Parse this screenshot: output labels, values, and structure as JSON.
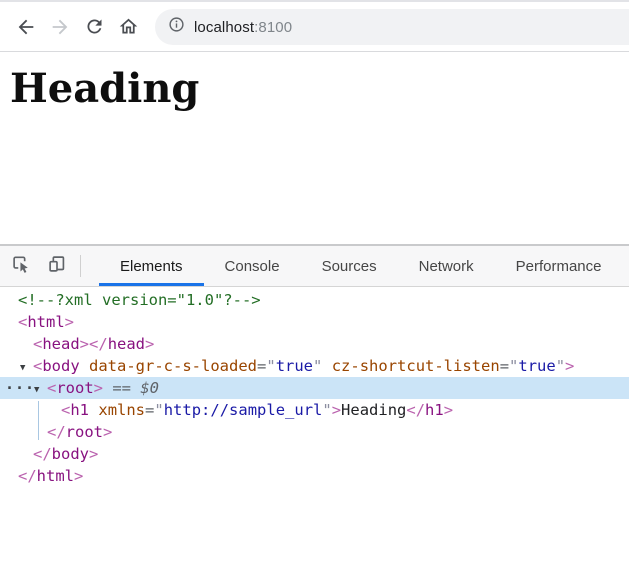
{
  "colors": {
    "accent_blue": "#1a73e8",
    "selected_row": "#cbe4f7",
    "syntax_comment": "#236e25",
    "syntax_tag": "#881280",
    "syntax_attr": "#994500",
    "syntax_value": "#1a1aa6"
  },
  "browser": {
    "icons": {
      "back": "arrow-left",
      "forward": "arrow-right",
      "reload": "refresh-circular-arrow",
      "home": "house-outline",
      "site_info": "info-circle"
    },
    "url": {
      "host": "localhost",
      "port": ":8100",
      "full": "localhost:8100"
    }
  },
  "page": {
    "heading": "Heading"
  },
  "devtools": {
    "toolbar_icons": {
      "inspect": "inspect-element-cursor",
      "device": "device-toolbar-phones"
    },
    "tabs": [
      {
        "label": "Elements",
        "active": true
      },
      {
        "label": "Console",
        "active": false
      },
      {
        "label": "Sources",
        "active": false
      },
      {
        "label": "Network",
        "active": false
      },
      {
        "label": "Performance",
        "active": false
      }
    ],
    "code": {
      "lines": [
        {
          "indent": 0,
          "segments": [
            {
              "t": "<!--?xml version=\"1.0\"?-->",
              "c": "comment"
            }
          ]
        },
        {
          "indent": 0,
          "segments": [
            {
              "t": "<",
              "c": "bracket"
            },
            {
              "t": "html",
              "c": "tag"
            },
            {
              "t": ">",
              "c": "bracket"
            }
          ]
        },
        {
          "indent": 1,
          "segments": [
            {
              "t": "<",
              "c": "bracket"
            },
            {
              "t": "head",
              "c": "tag"
            },
            {
              "t": ">",
              "c": "bracket"
            },
            {
              "t": "</",
              "c": "bracket"
            },
            {
              "t": "head",
              "c": "tag"
            },
            {
              "t": ">",
              "c": "bracket"
            }
          ]
        },
        {
          "indent": 1,
          "arrow": true,
          "segments": [
            {
              "t": "<",
              "c": "bracket"
            },
            {
              "t": "body",
              "c": "tag"
            },
            {
              "t": " ",
              "c": "plain"
            },
            {
              "t": "data-gr-c-s-loaded",
              "c": "attr"
            },
            {
              "t": "=",
              "c": "punct"
            },
            {
              "t": "\"",
              "c": "quote"
            },
            {
              "t": "true",
              "c": "value"
            },
            {
              "t": "\"",
              "c": "quote"
            },
            {
              "t": " ",
              "c": "plain"
            },
            {
              "t": "cz-shortcut-listen",
              "c": "attr"
            },
            {
              "t": "=",
              "c": "punct"
            },
            {
              "t": "\"",
              "c": "quote"
            },
            {
              "t": "true",
              "c": "value"
            },
            {
              "t": "\"",
              "c": "quote"
            },
            {
              "t": ">",
              "c": "bracket"
            }
          ]
        },
        {
          "indent": 2,
          "arrow": true,
          "selected": true,
          "dots": true,
          "segments": [
            {
              "t": "<",
              "c": "bracket"
            },
            {
              "t": "root",
              "c": "tag"
            },
            {
              "t": ">",
              "c": "bracket"
            },
            {
              "t": " == ",
              "c": "meta"
            },
            {
              "t": "$0",
              "c": "meta-italic"
            }
          ]
        },
        {
          "indent": 3,
          "segments": [
            {
              "t": "<",
              "c": "bracket"
            },
            {
              "t": "h1",
              "c": "tag"
            },
            {
              "t": " ",
              "c": "plain"
            },
            {
              "t": "xmlns",
              "c": "attr"
            },
            {
              "t": "=",
              "c": "punct"
            },
            {
              "t": "\"",
              "c": "quote"
            },
            {
              "t": "http://sample_url",
              "c": "value"
            },
            {
              "t": "\"",
              "c": "quote"
            },
            {
              "t": ">",
              "c": "bracket"
            },
            {
              "t": "Heading",
              "c": "text"
            },
            {
              "t": "</",
              "c": "bracket"
            },
            {
              "t": "h1",
              "c": "tag"
            },
            {
              "t": ">",
              "c": "bracket"
            }
          ]
        },
        {
          "indent": 2,
          "segments": [
            {
              "t": "</",
              "c": "bracket"
            },
            {
              "t": "root",
              "c": "tag"
            },
            {
              "t": ">",
              "c": "bracket"
            }
          ]
        },
        {
          "indent": 1,
          "segments": [
            {
              "t": "</",
              "c": "bracket"
            },
            {
              "t": "body",
              "c": "tag"
            },
            {
              "t": ">",
              "c": "bracket"
            }
          ]
        },
        {
          "indent": 0,
          "segments": [
            {
              "t": "</",
              "c": "bracket"
            },
            {
              "t": "html",
              "c": "tag"
            },
            {
              "t": ">",
              "c": "bracket"
            }
          ]
        }
      ]
    }
  }
}
